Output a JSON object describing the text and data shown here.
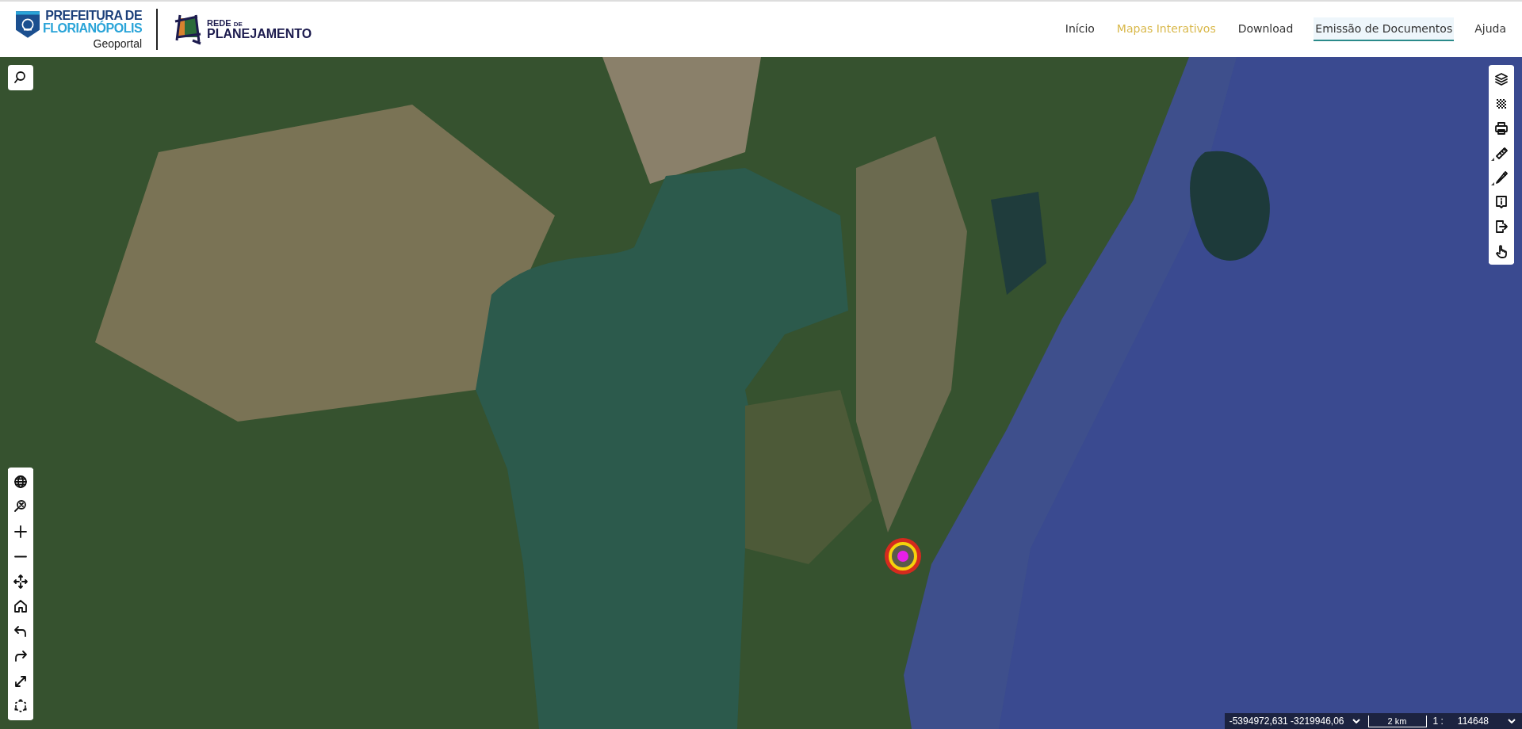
{
  "header": {
    "city_logo": {
      "line_1": "PREFEITURA DE",
      "line_2": "FLORIANÓPOLIS",
      "subtitle": "Geoportal"
    },
    "network_logo": {
      "word_1": "REDE",
      "word_2": "DE",
      "word_3": "PLANEJAMENTO"
    },
    "nav": [
      {
        "label": "Início",
        "selected": false,
        "hovered": false
      },
      {
        "label": "Mapas Interativos",
        "selected": true,
        "hovered": false
      },
      {
        "label": "Download",
        "selected": false,
        "hovered": false
      },
      {
        "label": "Emissão de Documentos",
        "selected": false,
        "hovered": true
      },
      {
        "label": "Ajuda",
        "selected": false,
        "hovered": false
      }
    ]
  },
  "map": {
    "search_button": {
      "kind": "search"
    },
    "right_toolbar": [
      {
        "kind": "layers",
        "has_submenu": false
      },
      {
        "kind": "checker",
        "has_submenu": false
      },
      {
        "kind": "print",
        "has_submenu": false
      },
      {
        "kind": "ruler",
        "has_submenu": true
      },
      {
        "kind": "pencil",
        "has_submenu": true
      },
      {
        "kind": "info",
        "has_submenu": false
      },
      {
        "kind": "exit",
        "has_submenu": false
      },
      {
        "kind": "hand",
        "has_submenu": false
      }
    ],
    "left_toolbar": [
      {
        "kind": "globe"
      },
      {
        "kind": "zoom-box"
      },
      {
        "kind": "plus"
      },
      {
        "kind": "minus"
      },
      {
        "kind": "pan"
      },
      {
        "kind": "home"
      },
      {
        "kind": "undo"
      },
      {
        "kind": "redo"
      },
      {
        "kind": "expand"
      },
      {
        "kind": "select"
      }
    ],
    "status_bar": {
      "coordinates": "-5394972,631 -3219946,06",
      "scale_bar": "2 km",
      "scale_prefix": "1 :",
      "scale_value": "114648"
    }
  }
}
